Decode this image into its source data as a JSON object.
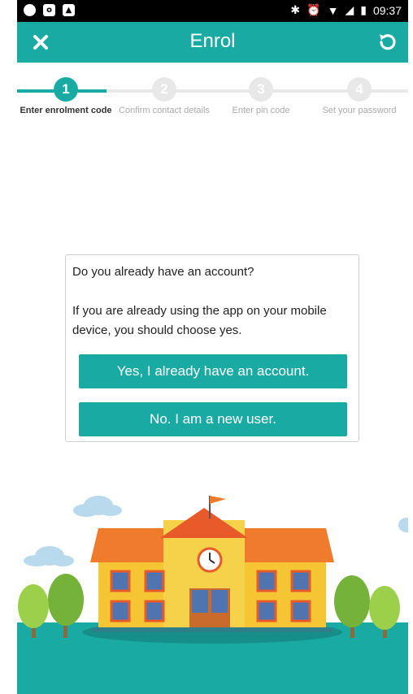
{
  "status_bar": {
    "time": "09:37",
    "left_icons": [
      "music-icon",
      "outlook-icon",
      "image-icon"
    ],
    "right_icons": [
      "bluetooth-icon",
      "alarm-icon",
      "wifi-icon",
      "signal-icon",
      "battery-icon"
    ]
  },
  "app_bar": {
    "title": "Enrol",
    "close_icon": "close-icon",
    "refresh_icon": "refresh-icon"
  },
  "stepper": {
    "steps": [
      {
        "number": "1",
        "label": "Enter enrolment code",
        "active": true
      },
      {
        "number": "2",
        "label": "Confirm contact details",
        "active": false
      },
      {
        "number": "3",
        "label": "Enter pin code",
        "active": false
      },
      {
        "number": "4",
        "label": "Set your password",
        "active": false
      }
    ]
  },
  "dialog": {
    "question": "Do you already have an account?",
    "description": "If you are already using the app on your mobile device, you should choose yes.",
    "yes_button": "Yes, I already have an account.",
    "no_button": "No. I am a new user."
  },
  "colors": {
    "accent": "#1aaaa4",
    "status_bar": "#000000",
    "inactive_step": "#e8e8e8",
    "ground": "#1aaaa4"
  },
  "illustration": {
    "name": "school-building-illustration"
  }
}
